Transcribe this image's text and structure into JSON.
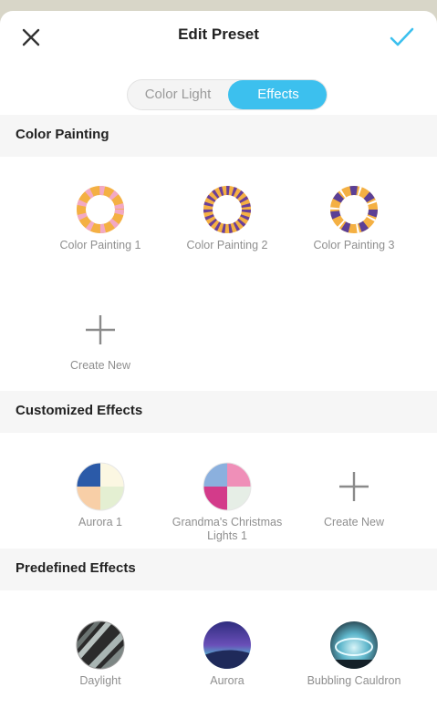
{
  "header": {
    "title": "Edit Preset"
  },
  "icons": {
    "close": "close-icon",
    "confirm": "checkmark-icon",
    "add": "plus-icon"
  },
  "tabs": [
    {
      "label": "Color Light",
      "active": false
    },
    {
      "label": "Effects",
      "active": true
    }
  ],
  "sections": {
    "color_painting": {
      "title": "Color Painting",
      "items": [
        {
          "label": "Color Painting 1"
        },
        {
          "label": "Color Painting 2"
        },
        {
          "label": "Color Painting 3"
        }
      ],
      "create_label": "Create New"
    },
    "customized": {
      "title": "Customized Effects",
      "items": [
        {
          "label": "Aurora 1"
        },
        {
          "label": "Grandma's Christmas Lights 1"
        }
      ],
      "create_label": "Create New"
    },
    "predefined": {
      "title": "Predefined Effects",
      "items": [
        {
          "label": "Daylight"
        },
        {
          "label": "Aurora"
        },
        {
          "label": "Bubbling Cauldron"
        }
      ]
    }
  },
  "colors": {
    "accent": "#3cc0ee",
    "section_bg": "#f6f6f6",
    "label": "#8f8f8f"
  }
}
